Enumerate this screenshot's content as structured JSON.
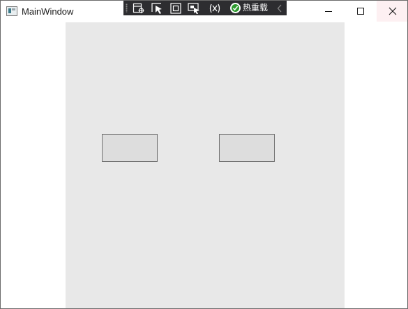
{
  "window": {
    "title": "MainWindow",
    "icon": "app-window-icon"
  },
  "debug_toolbar": {
    "icons": [
      "grip-handle-icon",
      "select-element-icon",
      "select-pointer-icon",
      "display-layout-adorners-icon",
      "track-focused-element-icon",
      "binding-failures-icon",
      "hot-reload-status-icon",
      "collapse-chevron-icon"
    ],
    "hot_reload_label": "热重载",
    "status_color": "#2e9a2e"
  },
  "caption_buttons": {
    "icons": [
      "minimize-icon",
      "maximize-icon",
      "close-icon"
    ]
  },
  "content": {
    "background": "#e8e8e8",
    "buttons": [
      {
        "label": ""
      },
      {
        "label": ""
      }
    ]
  }
}
